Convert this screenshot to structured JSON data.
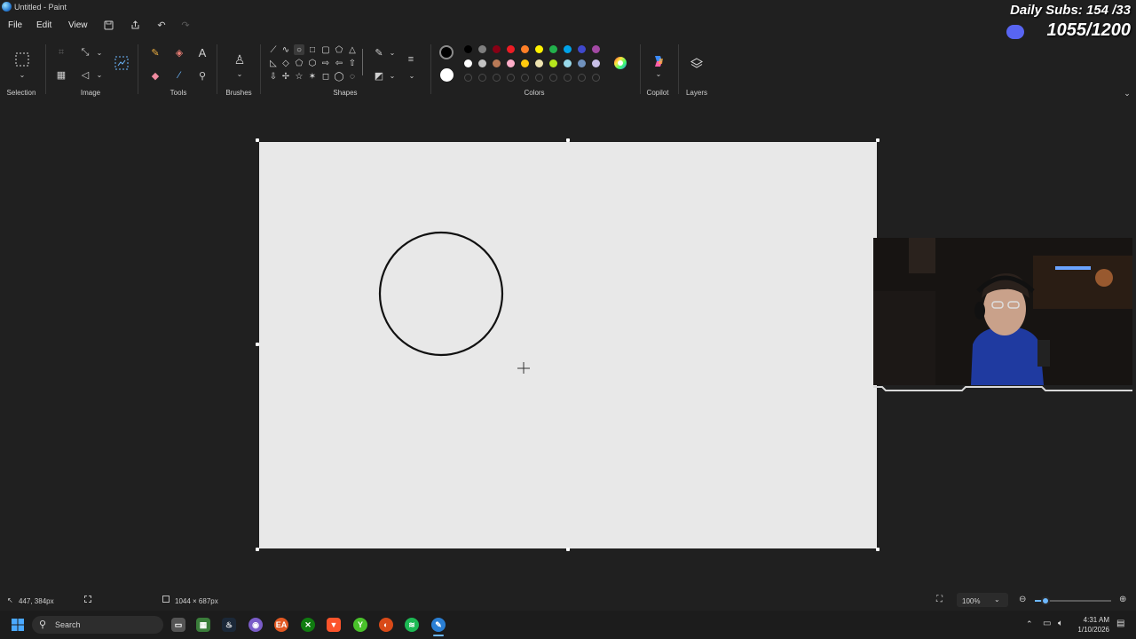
{
  "window": {
    "title": "Untitled - Paint"
  },
  "menu": {
    "file": "File",
    "edit": "Edit",
    "view": "View"
  },
  "ribbon": {
    "groups": {
      "selection": "Selection",
      "image": "Image",
      "tools": "Tools",
      "brushes": "Brushes",
      "shapes": "Shapes",
      "colors": "Colors",
      "copilot": "Copilot",
      "layers": "Layers"
    },
    "colors_row1": [
      "#000000",
      "#7f7f7f",
      "#880015",
      "#ed1c24",
      "#ff7f27",
      "#fff200",
      "#22b14c",
      "#00a2e8",
      "#3f48cc",
      "#a349a4"
    ],
    "colors_row2": [
      "#ffffff",
      "#c3c3c3",
      "#b97a57",
      "#ffaec9",
      "#ffc90e",
      "#efe4b0",
      "#b5e61d",
      "#99d9ea",
      "#7092be",
      "#c8bfe7"
    ],
    "primary_color": "#000000",
    "secondary_color": "#ffffff"
  },
  "status": {
    "cursor_position": "447, 384px",
    "canvas_size": "1044 × 687px",
    "zoom": "100%"
  },
  "taskbar": {
    "search_placeholder": "Search",
    "time": "4:31 AM",
    "date": "1/10/2026"
  },
  "overlay": {
    "daily_subs": "Daily Subs: 154 /33",
    "goal": "1055/1200"
  }
}
